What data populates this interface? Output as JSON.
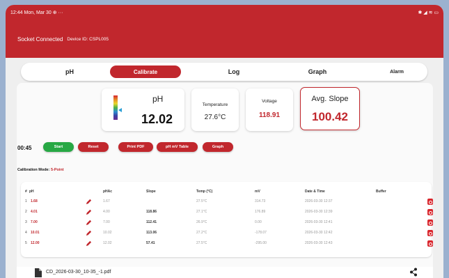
{
  "status_bar": {
    "time": "12:44",
    "date": "Mon, Mar 30",
    "extra": "⊕ ···",
    "icons": "✱ ◢ ≋ ▭"
  },
  "app_bar": {
    "connection_status": "Socket Connected",
    "device_id": "Device ID: CSPL005"
  },
  "tabs": [
    {
      "label": "pH",
      "active": false
    },
    {
      "label": "Calibrate",
      "active": true
    },
    {
      "label": "Log",
      "active": false
    },
    {
      "label": "Graph",
      "active": false
    },
    {
      "label": "Alarm",
      "active": false
    }
  ],
  "readings": {
    "ph": {
      "label": "pH",
      "value": "12.02"
    },
    "temperature": {
      "label": "Temperature",
      "value": "27.6°C"
    },
    "voltage": {
      "label": "Voltage",
      "value": "118.91"
    },
    "avg_slope": {
      "label": "Avg. Slope",
      "value": "100.42"
    }
  },
  "controls": {
    "timer": "00:45",
    "start": "Start",
    "reset": "Reset",
    "print_pdf": "Print PDF",
    "ph_mv_table": "pH mV Table",
    "graph": "Graph"
  },
  "calibration_mode": {
    "label": "Calibration Mode:",
    "value": "5-Point"
  },
  "table": {
    "headers": {
      "num": "#",
      "ph": "pH",
      "ph_ac": "pHAc",
      "slope": "Slope",
      "temp": "Temp (°C)",
      "mv": "mV",
      "datetime": "Date & Time",
      "buffer": "Buffer"
    },
    "rows": [
      {
        "num": "1",
        "ph": "1.68",
        "ph_ac": "1.67",
        "slope": "",
        "temp": "27.5°C",
        "mv": "314.73",
        "datetime": "2026-03-30 12:37"
      },
      {
        "num": "2",
        "ph": "4.01",
        "ph_ac": "4.00",
        "slope": "118.86",
        "temp": "27.1°C",
        "mv": "176.89",
        "datetime": "2026-03-30 12:39"
      },
      {
        "num": "3",
        "ph": "7.00",
        "ph_ac": "7.00",
        "slope": "112.41",
        "temp": "26.9°C",
        "mv": "0.00",
        "datetime": "2026-03-30 12:41"
      },
      {
        "num": "4",
        "ph": "10.01",
        "ph_ac": "10.02",
        "slope": "113.06",
        "temp": "27.2°C",
        "mv": "-178.07",
        "datetime": "2026-03-30 12:42"
      },
      {
        "num": "5",
        "ph": "12.00",
        "ph_ac": "12.02",
        "slope": "57.41",
        "temp": "27.5°C",
        "mv": "-295.00",
        "datetime": "2026-03-30 12:43"
      }
    ]
  },
  "file": {
    "name": "CD_2026-03-30_10-35_-1.pdf"
  },
  "colors": {
    "brand": "#c1272d",
    "background": "#9bb1cf"
  }
}
